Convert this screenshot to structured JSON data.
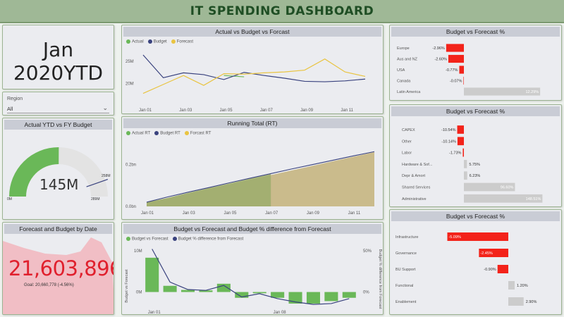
{
  "header": {
    "title": "IT SPENDING DASHBOARD"
  },
  "date_card": {
    "month": "Jan",
    "period": "2020YTD"
  },
  "region_slicer": {
    "label": "Region",
    "value": "All"
  },
  "gauge": {
    "title": "Actual YTD vs FY Budget",
    "value_label": "145M",
    "min_label": "0M",
    "max_label": "289M",
    "target_label": "258M",
    "value": 145,
    "min": 0,
    "max": 289,
    "target": 258
  },
  "kpi_card": {
    "title": "Forecast and Budget by Date",
    "value": "21,603,896",
    "goal_text": "Goal: 20,660,778 (-4.56%)"
  },
  "colors": {
    "actual": "#6ab858",
    "budget": "#39427e",
    "forecast": "#e9c441",
    "negative": "#f3231a",
    "positive": "#cccccc",
    "panel_title_bg": "#c9ccd5",
    "header_bg": "#9fb896"
  },
  "chart_data": [
    {
      "id": "avb",
      "type": "line",
      "title": "Actual vs Budget vs Forcast",
      "legend": [
        "Actual",
        "Budget",
        "Forecast"
      ],
      "x_ticks": [
        "Jan 01",
        "Jan 03",
        "Jan 05",
        "Jan 07",
        "Jan 09",
        "Jan 11"
      ],
      "y_ticks": [
        "25M",
        "20M"
      ],
      "y_tick_values": [
        25,
        20
      ],
      "ylim": [
        16,
        27.5
      ],
      "series": [
        {
          "name": "Actual",
          "values": [
            null,
            null,
            null,
            null,
            21.8,
            21.5,
            null,
            null,
            null,
            null,
            null
          ]
        },
        {
          "name": "Budget",
          "values": [
            26.4,
            21.3,
            22.4,
            22.0,
            20.9,
            22.5,
            21.8,
            21.2,
            20.5,
            20.4,
            20.6,
            21.0
          ]
        },
        {
          "name": "Forecast",
          "values": [
            17.8,
            19.8,
            21.8,
            19.6,
            22.2,
            22.1,
            22.4,
            22.6,
            23.0,
            25.5,
            22.6,
            21.6
          ]
        }
      ]
    },
    {
      "id": "running_total",
      "type": "area",
      "title": "Running Total (RT)",
      "legend": [
        "Actual RT",
        "Budget RT",
        "Forcast RT"
      ],
      "x_ticks": [
        "Jan 01",
        "Jan 03",
        "Jan 05",
        "Jan 07",
        "Jan 09",
        "Jan 11"
      ],
      "y_ticks": [
        "0.2bn",
        "0.0bn"
      ],
      "y_tick_values": [
        0.2,
        0.0
      ],
      "ylim": [
        0,
        0.3
      ],
      "series": [
        {
          "name": "Actual RT",
          "values": [
            0.02,
            0.04,
            0.065,
            0.088,
            0.11,
            0.133,
            0.155
          ]
        },
        {
          "name": "Budget RT",
          "values": [
            0.02,
            0.045,
            0.068,
            0.09,
            0.113,
            0.135,
            0.157,
            0.179,
            0.2,
            0.221,
            0.242,
            0.262
          ]
        },
        {
          "name": "Forcast RT",
          "values": [
            0.018,
            0.04,
            0.062,
            0.084,
            0.106,
            0.128,
            0.15,
            0.172,
            0.194,
            0.216,
            0.238,
            0.26
          ]
        }
      ]
    },
    {
      "id": "bvf_diff",
      "type": "bar",
      "title": "Budget vs Forecast and Budget % difference from Forecast",
      "legend": [
        "Budget vs Forecast",
        "Budget % difference from Forecast"
      ],
      "x_ticks": [
        "Jan 01",
        "Jan 08"
      ],
      "ylabel_left": "Budget vs Forecast",
      "ylabel_right": "Budget % difference from Forecast",
      "y_ticks_left": [
        "10M",
        "0M"
      ],
      "y_ticks_right": [
        "50%",
        "0%"
      ],
      "ylim_left": [
        -4,
        11
      ],
      "ylim_right": [
        -20,
        55
      ],
      "bars": [
        8.3,
        1.5,
        0.5,
        0.4,
        2.0,
        -1.4,
        -0.3,
        -1.4,
        -2.8,
        -2.8,
        -2.2,
        -1.4
      ],
      "line": [
        52,
        12,
        3,
        2,
        8,
        -6,
        -2,
        -8,
        -12,
        -15,
        -14,
        -8
      ]
    },
    {
      "id": "bvf_region",
      "type": "bar",
      "title": "Budget vs Forecast %",
      "categories": [
        "Europe",
        "Aus and NZ",
        "USA",
        "Canada",
        "Latin America"
      ],
      "values": [
        -2.96,
        -2.6,
        -0.77,
        -0.07,
        12.29
      ],
      "labels": [
        "-2.96%",
        "-2.60%",
        "-0.77%",
        "-0.07%",
        "12.29%"
      ]
    },
    {
      "id": "bvf_type",
      "type": "bar",
      "title": "Budget vs Forecast %",
      "categories": [
        "CAPEX",
        "Other",
        "Labor",
        "Hardware & Sof...",
        "Depr & Amort",
        "Shared Services",
        "Administrative"
      ],
      "values": [
        -10.54,
        -10.14,
        -1.73,
        5.75,
        6.23,
        96.6,
        148.51
      ],
      "labels": [
        "-10.54%",
        "-10.14%",
        "-1.73%",
        "5.75%",
        "6.23%",
        "96.60%",
        "148.51%"
      ]
    },
    {
      "id": "bvf_tower",
      "type": "bar",
      "title": "Budget vs Forecast %",
      "categories": [
        "Infrastructure",
        "Governance",
        "BU Support",
        "Functional",
        "Enablement"
      ],
      "values": [
        -5.09,
        -2.45,
        -0.9,
        1.2,
        2.9
      ],
      "labels": [
        "-5.09%",
        "-2.45%",
        "-0.90%",
        "1.20%",
        "2.90%"
      ]
    }
  ]
}
